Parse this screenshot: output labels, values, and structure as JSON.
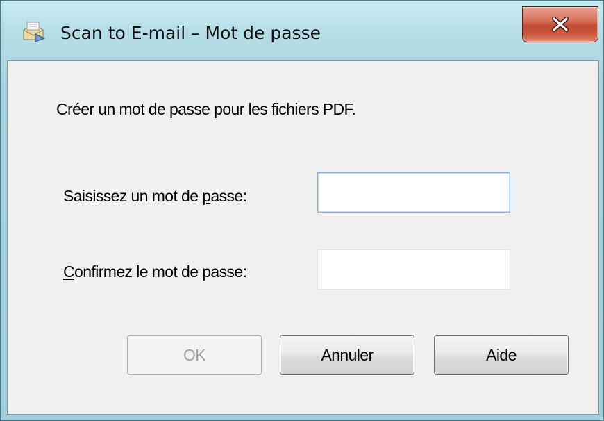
{
  "window": {
    "title": "Scan to E-mail – Mot de passe",
    "close_icon": "close-x-icon",
    "app_icon": "scanner-envelope-icon"
  },
  "dialog": {
    "prompt": "Créer un mot de passe pour les fichiers PDF.",
    "password_label_pre": "Saisissez un mot de ",
    "password_label_mnemonic": "p",
    "password_label_post": "asse:",
    "password_value": "",
    "confirm_label_mnemonic": "C",
    "confirm_label_post": "onfirmez le mot de passe:",
    "confirm_value": ""
  },
  "buttons": {
    "ok": "OK",
    "ok_enabled": false,
    "cancel": "Annuler",
    "help": "Aide"
  },
  "colors": {
    "frame": "#a9d4df",
    "client_bg": "#f0f0f0",
    "close_button": "#c24a30",
    "focus_border": "#7eb4ea",
    "disabled_text": "#a0a0a0"
  }
}
